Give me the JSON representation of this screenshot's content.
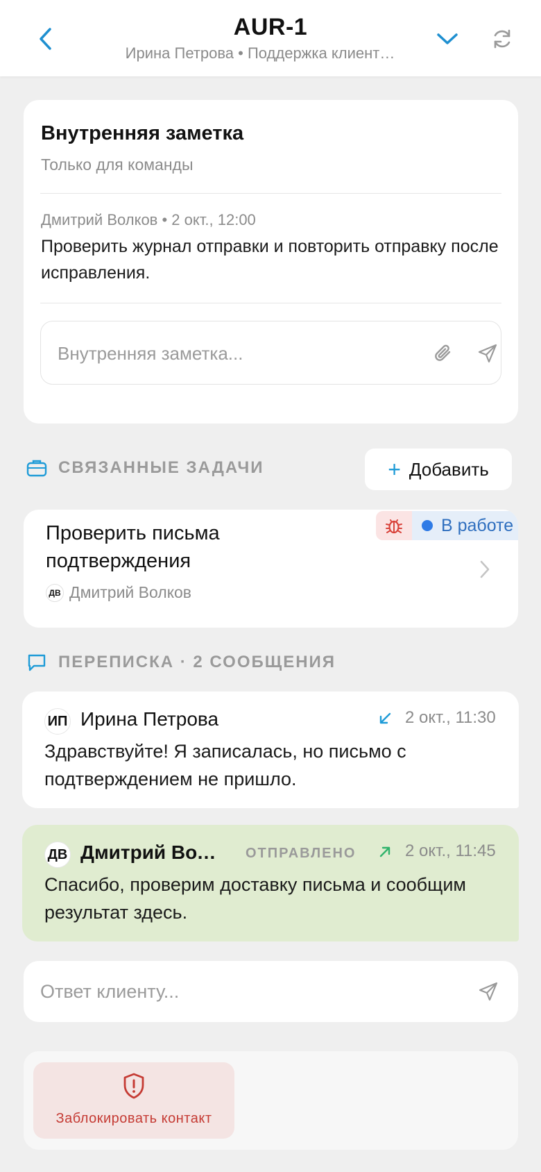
{
  "header": {
    "title": "AUR-1",
    "subtitle": "Ирина Петрова • Поддержка клиент…"
  },
  "note": {
    "title": "Внутренняя заметка",
    "subtitle": "Только для команды",
    "meta": "Дмитрий Волков • 2 окт., 12:00",
    "text": "Проверить журнал отправки и повторить отправку после исправления.",
    "input_placeholder": "Внутренняя заметка..."
  },
  "related": {
    "label": "СВЯЗАННЫЕ ЗАДАЧИ",
    "add_label": "Добавить",
    "task": {
      "title": "Проверить письма подтверждения",
      "status": "В работе",
      "assignee_initials": "ДВ",
      "assignee": "Дмитрий Волков"
    }
  },
  "correspondence": {
    "label": "ПЕРЕПИСКА · 2 СООБЩЕНИЯ",
    "messages": [
      {
        "initials": "ИП",
        "author": "Ирина Петрова",
        "time": "2 окт., 11:30",
        "text": "Здравствуйте! Я записалась, но письмо с подтверждением не пришло."
      },
      {
        "initials": "ДВ",
        "author": "Дмитрий Волков",
        "status": "ОТПРАВЛЕНО",
        "time": "2 окт., 11:45",
        "text": "Спасибо, проверим доставку письма и сообщим результат здесь."
      }
    ]
  },
  "reply": {
    "placeholder": "Ответ клиенту..."
  },
  "actions": {
    "block_label": "Заблокировать контакт"
  },
  "colors": {
    "accent": "#1e9bd7",
    "danger": "#c53b34",
    "status_blue": "#2f7be6",
    "outgoing_bg": "#e0ecd0",
    "incoming_arrow": "#1e9bd7",
    "outgoing_arrow": "#2fb36b"
  },
  "icons": {
    "back": "chevron-left-icon",
    "collapse": "chevron-down-icon",
    "refresh": "refresh-icon",
    "attach": "paperclip-icon",
    "send": "send-icon",
    "tasks": "briefcase-icon",
    "bug": "bug-icon",
    "chat": "chat-bubble-icon",
    "incoming": "arrow-down-left-icon",
    "outgoing": "arrow-up-right-icon",
    "shield": "shield-alert-icon"
  }
}
